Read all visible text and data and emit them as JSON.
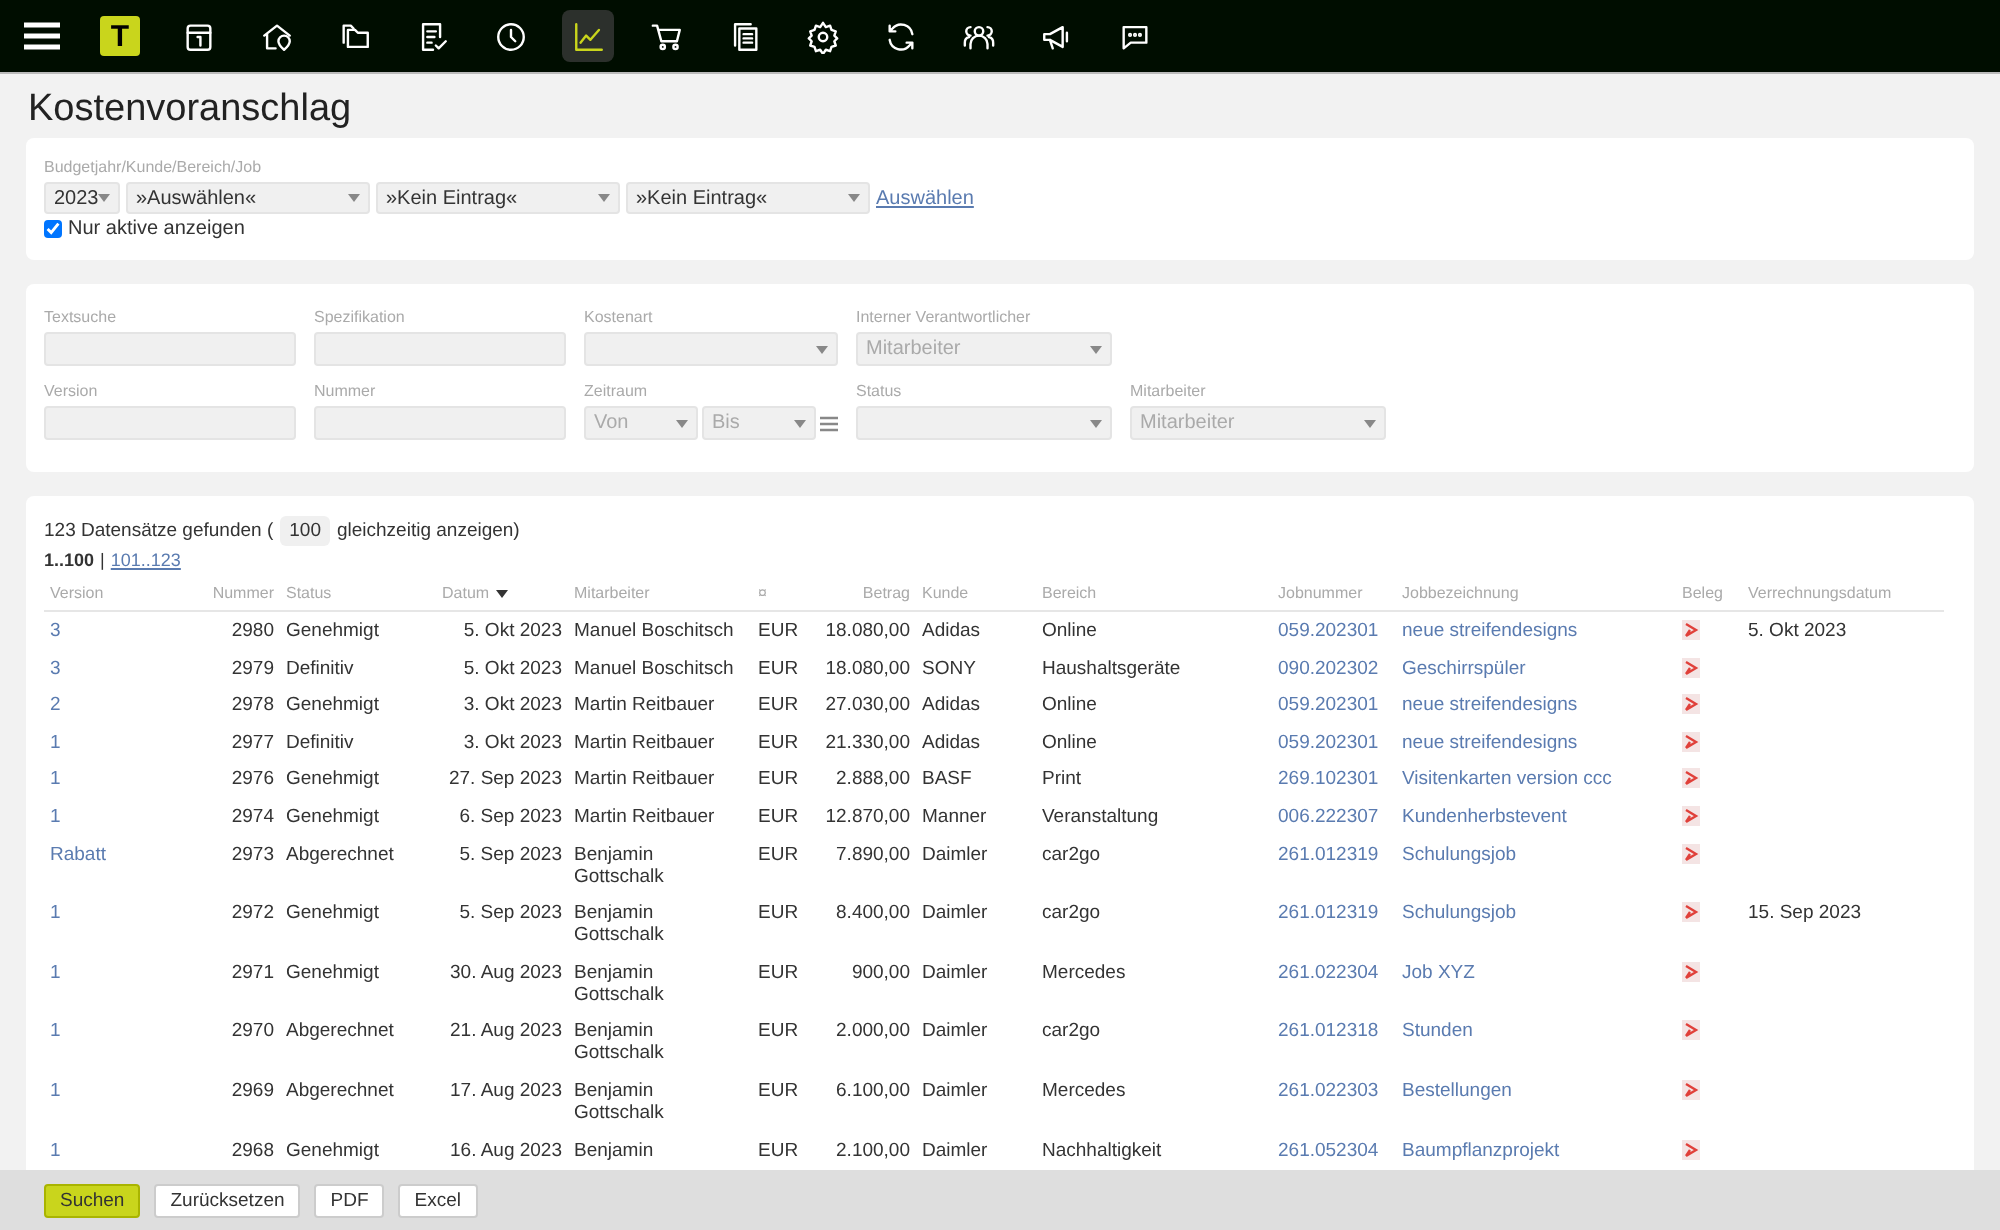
{
  "nav": {
    "logo": "T",
    "items": [
      {
        "selected": false
      },
      {
        "selected": false
      },
      {
        "selected": false
      },
      {
        "selected": false
      },
      {
        "selected": false
      },
      {
        "selected": true
      },
      {
        "selected": false
      },
      {
        "selected": false
      },
      {
        "selected": false
      },
      {
        "selected": false
      },
      {
        "selected": false
      },
      {
        "selected": false
      },
      {
        "selected": false
      }
    ]
  },
  "title": "Kostenvoranschlag",
  "job_filter": {
    "label": "Budgetjahr/Kunde/Bereich/Job",
    "selects": [
      {
        "value": "2023"
      },
      {
        "value": "»Auswählen«"
      },
      {
        "value": "»Kein Eintrag«"
      },
      {
        "value": "»Kein Eintrag«"
      }
    ],
    "link": "Auswählen",
    "active_only": {
      "label": "Nur aktive anzeigen",
      "checked": true
    }
  },
  "filters": [
    [
      {
        "label": "Textsuche",
        "kind": "text"
      },
      {
        "label": "Spezifikation",
        "kind": "text"
      },
      {
        "label": "Kostenart",
        "kind": "select"
      },
      {
        "label": "Interner Verantwortlicher",
        "kind": "select",
        "placeholder": "Mitarbeiter"
      }
    ],
    [
      {
        "label": "Version",
        "kind": "text"
      },
      {
        "label": "Nummer",
        "kind": "text"
      },
      {
        "label": "Zeitraum",
        "kind": "range",
        "from": "Von",
        "to": "Bis"
      },
      {
        "label": "Status",
        "kind": "select"
      },
      {
        "label": "Mitarbeiter",
        "kind": "select",
        "placeholder": "Mitarbeiter"
      }
    ]
  ],
  "results": {
    "found": "123 Datensätze gefunden (",
    "page_size": "100",
    "per_page": "gleichzeitig anzeigen)",
    "pages": [
      {
        "label": "1..100",
        "selected": true
      },
      {
        "label": "101..123",
        "selected": false
      }
    ],
    "separator": "|"
  },
  "table": {
    "columns": [
      "Version",
      "Nummer",
      "Status",
      "Datum",
      "Mitarbeiter",
      "¤",
      "Betrag",
      "Kunde",
      "Bereich",
      "Jobnummer",
      "Jobbezeichnung",
      "Beleg",
      "Verrechnungsdatum"
    ],
    "rows": [
      {
        "version": "3",
        "number": "2980",
        "status": "Genehmigt",
        "date": "5. Okt 2023",
        "employee": "Manuel Boschitsch",
        "currency": "EUR",
        "amount": "18.080,00",
        "customer": "Adidas",
        "area": "Online",
        "job_number": "059.202301",
        "job_name": "neue streifendesigns",
        "billing_date": "5. Okt 2023"
      },
      {
        "version": "3",
        "number": "2979",
        "status": "Definitiv",
        "date": "5. Okt 2023",
        "employee": "Manuel Boschitsch",
        "currency": "EUR",
        "amount": "18.080,00",
        "customer": "SONY",
        "area": "Haushaltsgeräte",
        "job_number": "090.202302",
        "job_name": "Geschirrspüler"
      },
      {
        "version": "2",
        "number": "2978",
        "status": "Genehmigt",
        "date": "3. Okt 2023",
        "employee": "Martin Reitbauer",
        "currency": "EUR",
        "amount": "27.030,00",
        "customer": "Adidas",
        "area": "Online",
        "job_number": "059.202301",
        "job_name": "neue streifendesigns"
      },
      {
        "version": "1",
        "number": "2977",
        "status": "Definitiv",
        "date": "3. Okt 2023",
        "employee": "Martin Reitbauer",
        "currency": "EUR",
        "amount": "21.330,00",
        "customer": "Adidas",
        "area": "Online",
        "job_number": "059.202301",
        "job_name": "neue streifendesigns"
      },
      {
        "version": "1",
        "number": "2976",
        "status": "Genehmigt",
        "date": "27. Sep 2023",
        "employee": "Martin Reitbauer",
        "currency": "EUR",
        "amount": "2.888,00",
        "customer": "BASF",
        "area": "Print",
        "job_number": "269.102301",
        "job_name": "Visitenkarten version ccc"
      },
      {
        "version": "1",
        "number": "2974",
        "status": "Genehmigt",
        "date": "6. Sep 2023",
        "employee": "Martin Reitbauer",
        "currency": "EUR",
        "amount": "12.870,00",
        "customer": "Manner",
        "area": "Veranstaltung",
        "job_number": "006.222307",
        "job_name": "Kundenherbstevent"
      },
      {
        "version": "Rabatt",
        "number": "2973",
        "status": "Abgerechnet",
        "date": "5. Sep 2023",
        "employee": "Benjamin Gottschalk",
        "currency": "EUR",
        "amount": "7.890,00",
        "customer": "Daimler",
        "area": "car2go",
        "job_number": "261.012319",
        "job_name": "Schulungsjob"
      },
      {
        "version": "1",
        "number": "2972",
        "status": "Genehmigt",
        "date": "5. Sep 2023",
        "employee": "Benjamin Gottschalk",
        "currency": "EUR",
        "amount": "8.400,00",
        "customer": "Daimler",
        "area": "car2go",
        "job_number": "261.012319",
        "job_name": "Schulungsjob",
        "billing_date": "15. Sep 2023"
      },
      {
        "version": "1",
        "number": "2971",
        "status": "Genehmigt",
        "date": "30. Aug 2023",
        "employee": "Benjamin Gottschalk",
        "currency": "EUR",
        "amount": "900,00",
        "customer": "Daimler",
        "area": "Mercedes",
        "job_number": "261.022304",
        "job_name": "Job XYZ"
      },
      {
        "version": "1",
        "number": "2970",
        "status": "Abgerechnet",
        "date": "21. Aug 2023",
        "employee": "Benjamin Gottschalk",
        "currency": "EUR",
        "amount": "2.000,00",
        "customer": "Daimler",
        "area": "car2go",
        "job_number": "261.012318",
        "job_name": "Stunden"
      },
      {
        "version": "1",
        "number": "2969",
        "status": "Abgerechnet",
        "date": "17. Aug 2023",
        "employee": "Benjamin Gottschalk",
        "currency": "EUR",
        "amount": "6.100,00",
        "customer": "Daimler",
        "area": "Mercedes",
        "job_number": "261.022303",
        "job_name": "Bestellungen"
      },
      {
        "version": "1",
        "number": "2968",
        "status": "Genehmigt",
        "date": "16. Aug 2023",
        "employee": "Benjamin",
        "currency": "EUR",
        "amount": "2.100,00",
        "customer": "Daimler",
        "area": "Nachhaltigkeit",
        "job_number": "261.052304",
        "job_name": "Baumpflanzprojekt"
      }
    ]
  },
  "footer": {
    "buttons": [
      {
        "label": "Suchen",
        "kind": "primary"
      },
      {
        "label": "Zurücksetzen",
        "kind": "default"
      },
      {
        "label": "PDF",
        "kind": "default"
      },
      {
        "label": "Excel",
        "kind": "default"
      }
    ]
  }
}
